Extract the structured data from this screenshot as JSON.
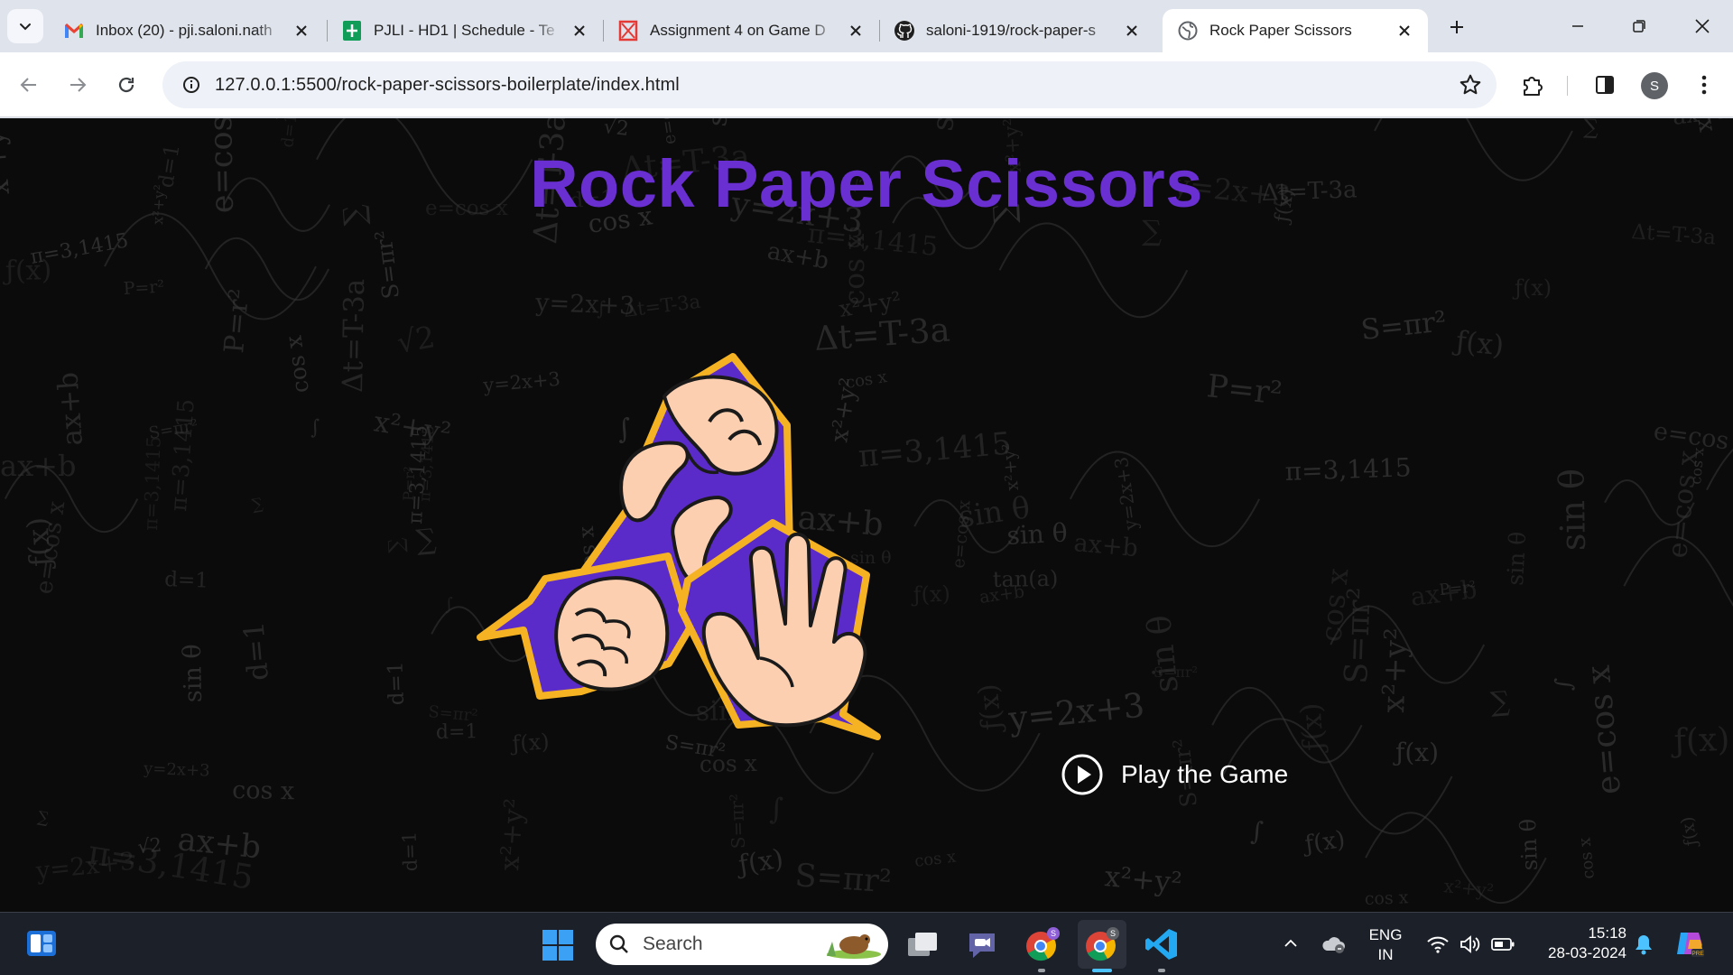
{
  "browser": {
    "tabs": [
      {
        "title": "Inbox (20) - pji.saloni.nath",
        "icon": "gmail-icon"
      },
      {
        "title": "PJLI - HD1 | Schedule - Te",
        "icon": "sheets-icon"
      },
      {
        "title": "Assignment 4 on Game D",
        "icon": "assignment-icon"
      },
      {
        "title": "saloni-1919/rock-paper-s",
        "icon": "github-icon"
      },
      {
        "title": "Rock Paper Scissors",
        "icon": "globe-icon",
        "active": true
      }
    ],
    "url": "127.0.0.1:5500/rock-paper-scissors-boilerplate/index.html",
    "profile_initial": "S"
  },
  "page": {
    "title": "Rock Paper Scissors",
    "play_label": "Play the Game"
  },
  "taskbar": {
    "search_placeholder": "Search",
    "lang_line1": "ENG",
    "lang_line2": "IN",
    "time": "15:18",
    "date": "28-03-2024"
  },
  "colors": {
    "accent_purple": "#6a2fd0",
    "badge_purple": "#5b2bc9",
    "badge_border": "#f5b324",
    "skin": "#fccfb1"
  }
}
